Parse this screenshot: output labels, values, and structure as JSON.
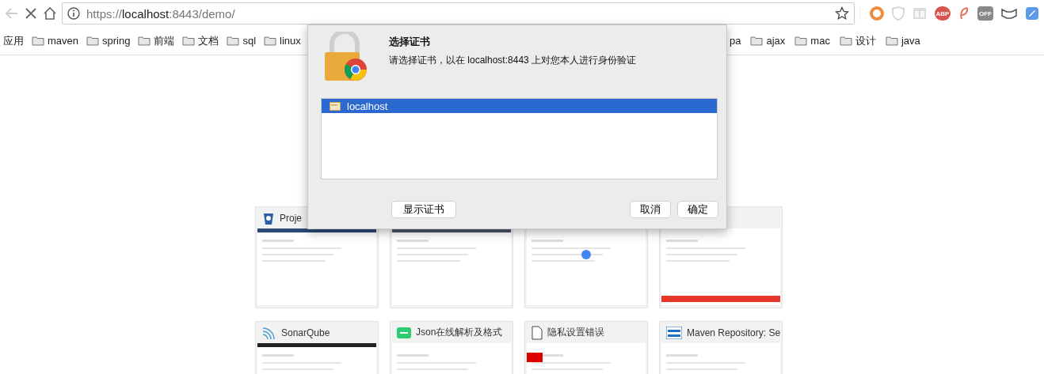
{
  "toolbar": {
    "back_disabled": true,
    "url": "https://**localhost**:8443/demo/",
    "extensions": [
      {
        "kind": "ring"
      },
      {
        "kind": "shield"
      },
      {
        "kind": "grid"
      },
      {
        "kind": "abp",
        "label": "ABP"
      },
      {
        "kind": "leaf"
      },
      {
        "kind": "off",
        "label": "OFF"
      },
      {
        "kind": "mask"
      },
      {
        "kind": "tag"
      }
    ]
  },
  "bookmarks_left": [
    {
      "kind": "apps",
      "label": "应用"
    },
    {
      "kind": "folder",
      "label": "maven"
    },
    {
      "kind": "folder",
      "label": "spring"
    },
    {
      "kind": "folder",
      "label": "前端"
    },
    {
      "kind": "folder",
      "label": "文档"
    },
    {
      "kind": "folder",
      "label": "sql"
    },
    {
      "kind": "folder",
      "label": "linux"
    }
  ],
  "bookmarks_right": [
    {
      "kind": "text",
      "label": "pa"
    },
    {
      "kind": "folder",
      "label": "ajax"
    },
    {
      "kind": "folder",
      "label": "mac"
    },
    {
      "kind": "folder",
      "label": "设计"
    },
    {
      "kind": "folder",
      "label": "java"
    }
  ],
  "dialog": {
    "title": "选择证书",
    "message": "请选择证书，以在 localhost:8443 上对您本人进行身份验证",
    "certificates": [
      {
        "name": "localhost",
        "selected": true
      }
    ],
    "buttons": [
      {
        "kind": "left",
        "label": "显示证书"
      },
      {
        "kind": "right",
        "label": "取消"
      },
      {
        "kind": "right",
        "label": "确定"
      }
    ]
  },
  "tiles": [
    {
      "title": "Proje",
      "kind": "bucket"
    },
    {
      "kind": "blank"
    },
    {
      "kind": "blank"
    },
    {
      "kind": "blank"
    },
    {
      "title": "SonarQube",
      "kind": "sonar"
    },
    {
      "title": "Json在线解析及格式",
      "kind": "json"
    },
    {
      "title": "隐私设置错误",
      "kind": "page"
    },
    {
      "title": "Maven Repository: Se",
      "kind": "mvn"
    }
  ]
}
